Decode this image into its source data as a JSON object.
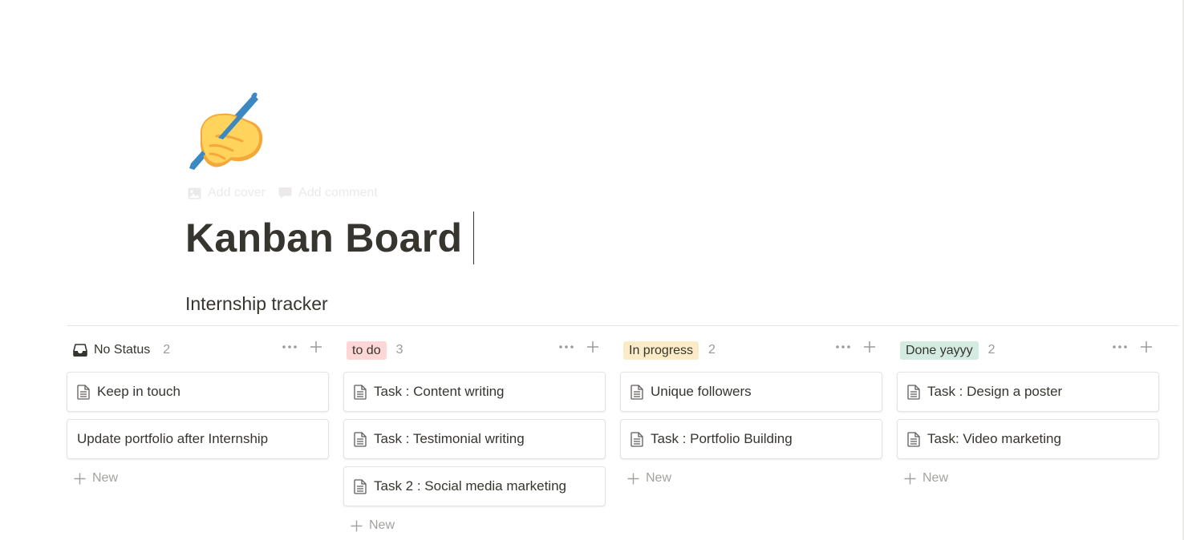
{
  "page": {
    "icon": "writing-hand-emoji",
    "add_cover_label": "Add cover",
    "add_comment_label": "Add comment",
    "title": "Kanban Board",
    "subtitle": "Internship tracker"
  },
  "board": {
    "new_label": "New",
    "columns": [
      {
        "status": "No Status",
        "count": "2",
        "tag_color": "none",
        "cards": [
          "Keep in touch",
          "Update portfolio after Internship"
        ]
      },
      {
        "status": "to do",
        "count": "3",
        "tag_color": "#ffd6d6",
        "cards": [
          "Task : Content writing",
          "Task : Testimonial writing",
          "Task 2 : Social media marketing"
        ]
      },
      {
        "status": "In progress",
        "count": "2",
        "tag_color": "#fbecc7",
        "cards": [
          "Unique followers",
          "Task : Portfolio Building"
        ]
      },
      {
        "status": "Done yayyy",
        "count": "2",
        "tag_color": "#d4ebe2",
        "cards": [
          "Task : Design a poster",
          "Task: Video marketing"
        ]
      }
    ]
  }
}
